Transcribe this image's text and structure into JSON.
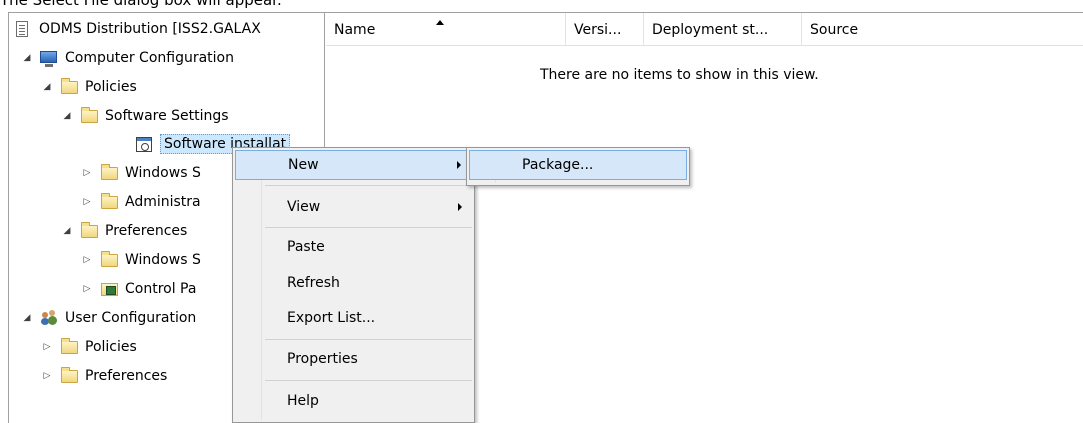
{
  "caption": "The Select File dialog box will appear.",
  "tree": {
    "root": "ODMS Distribution [ISS2.GALAX",
    "computer_config": "Computer Configuration",
    "policies": "Policies",
    "software_settings": "Software Settings",
    "software_installation": "Software installat",
    "windows_settings": "Windows S",
    "admin_templates": "Administra",
    "preferences": "Preferences",
    "pref_windows_settings": "Windows S",
    "control_panel": "Control Pa",
    "user_config": "User Configuration",
    "user_policies": "Policies",
    "user_preferences": "Preferences"
  },
  "list": {
    "columns": [
      "Name",
      "Versi...",
      "Deployment st...",
      "Source"
    ],
    "empty_message": "There are no items to show in this view."
  },
  "context_menu": {
    "new": "New",
    "view": "View",
    "paste": "Paste",
    "refresh": "Refresh",
    "export_list": "Export List...",
    "properties": "Properties",
    "help": "Help"
  },
  "submenu": {
    "package": "Package..."
  }
}
